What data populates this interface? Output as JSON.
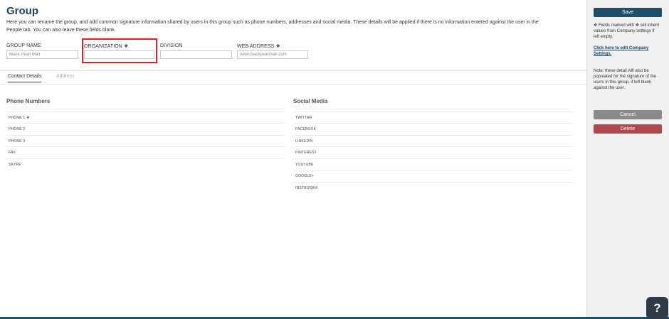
{
  "page": {
    "title": "Group",
    "description": "Here you can rename the group, and add common signature information shared by users in this group such as phone numbers, addresses and social media. These details will be applied if there is no information entered against the user in the People tab. You can also leave these fields blank."
  },
  "fields": {
    "group_name": {
      "label": "GROUP NAME",
      "placeholder": "Black Pearl Mall",
      "value": ""
    },
    "organization": {
      "label": "ORGANIZATION ❖",
      "placeholder": "",
      "value": ""
    },
    "division": {
      "label": "DIVISION",
      "placeholder": "",
      "value": ""
    },
    "web_address": {
      "label": "WEB ADDRESS ❖",
      "placeholder": "www.blackpearlmall.com",
      "value": ""
    }
  },
  "tabs": [
    {
      "label": "Contact Details",
      "active": true
    },
    {
      "label": "Address",
      "active": false
    }
  ],
  "phone_numbers": {
    "title": "Phone Numbers",
    "rows": [
      "PHONE 1 ❖",
      "PHONE 2",
      "PHONE 3",
      "FAX",
      "SKYPE"
    ]
  },
  "social_media": {
    "title": "Social Media",
    "rows": [
      "TWITTER",
      "FACEBOOK",
      "LINKEDIN",
      "PINTEREST",
      "YOUTUBE",
      "GOOGLE+",
      "INSTAGRAM"
    ]
  },
  "sidebar": {
    "save_label": "Save",
    "inherit_note": "❖ Fields marked with ❖ will inherit values from Company settings if left empty.",
    "edit_link": "Click here to edit Company Settings.",
    "populate_note": "Note: these detail will also be populated for the signature of the users in this group, if left blank against the user.",
    "cancel_label": "Cancel",
    "delete_label": "Delete"
  },
  "help": {
    "label": "?"
  },
  "colors": {
    "primary": "#1f4e6b",
    "danger": "#b0474a",
    "neutral": "#8a8a8a",
    "highlight": "#e02020"
  }
}
